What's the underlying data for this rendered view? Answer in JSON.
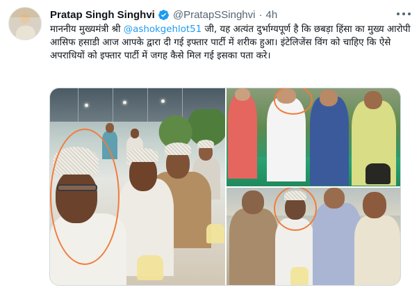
{
  "author": {
    "name": "Pratap Singh Singhvi",
    "handle": "@PratapSSinghvi",
    "separator": "·",
    "time": "4h"
  },
  "tweet": {
    "text_before": "माननीय मुख्यमंत्री श्री ",
    "mention": "@ashokgehlot51",
    "text_after": " जी, यह अत्यंत दुर्भाग्यपूर्ण है कि छबड़ा हिंसा का मुख्य आरोपी आसिफ हसाडी आज आपके द्वारा दी गई इफ्तार पार्टी में शरीक हुआ। इंटेलिजेंस विंग को चाहिए कि ऐसे अपराधियों को इफ्तार पार्टी में जगह कैसे मिल गई इसका पता करे।"
  },
  "colors": {
    "accent": "#1d9bf0",
    "annotation": "#f07c3c",
    "text": "#0f1419",
    "muted": "#536471"
  },
  "icons": {
    "verified": "verified-badge-icon",
    "more": "more-options-icon"
  }
}
